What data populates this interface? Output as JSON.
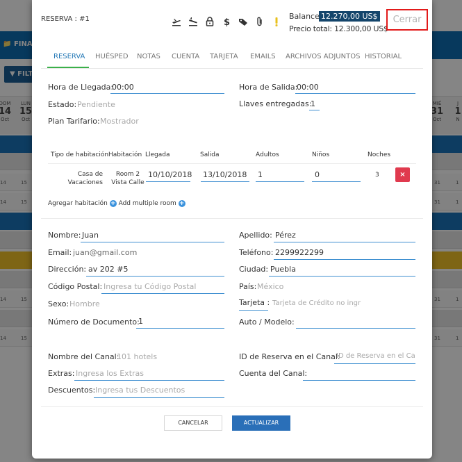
{
  "background": {
    "nav_label": "FINA",
    "filter_label": "FILT",
    "calendar_left": [
      {
        "dow": "DOM",
        "day": "14",
        "month": "Oct"
      },
      {
        "dow": "LUN",
        "day": "15",
        "month": "Oct"
      }
    ],
    "calendar_right": [
      {
        "dow": "MIÉ",
        "day": "31",
        "month": "Oct"
      },
      {
        "dow": "J",
        "day": "1",
        "month": "N"
      }
    ],
    "row_numbers": [
      "14",
      "15",
      "31",
      "1"
    ]
  },
  "modal": {
    "reservation_title": "RESERVA : #1",
    "icons": [
      "plane-departure-icon",
      "plane-arrival-icon",
      "lock-icon",
      "dollar-icon",
      "tags-icon",
      "paperclip-icon",
      "exclamation-icon"
    ],
    "balance_label": "Balance:",
    "balance_value": "12.270,00 US$",
    "total_label": "Precio total: 12.300,00 US$",
    "close_label": "Cerrar",
    "tabs": [
      "RESERVA",
      "HUÉSPED",
      "NOTAS",
      "CUENTA",
      "TARJETA",
      "EMAILS",
      "ARCHIVOS ADJUNTOS",
      "HISTORIAL"
    ],
    "active_tab": "RESERVA",
    "stay": {
      "arrival_label": "Hora de Llegada:",
      "arrival_value": "00:00",
      "departure_label": "Hora de Salida:",
      "departure_value": "00:00",
      "status_label": "Estado:",
      "status_value": "Pendiente",
      "keys_label": "Llaves entregadas:",
      "keys_value": "1",
      "rate_label": "Plan Tarifario:",
      "rate_value": "Mostrador"
    },
    "rooms_table": {
      "headers": [
        "Tipo de habitación",
        "Habitación",
        "Llegada",
        "Salida",
        "Adultos",
        "Niños",
        "Noches"
      ],
      "row": {
        "type_line1": "Casa de",
        "type_line2": "Vacaciones",
        "room_line1": "Room 2",
        "room_line2": "Vista Calle",
        "arrival": "10/10/2018",
        "departure": "13/10/2018",
        "adults": "1",
        "children": "0",
        "nights": "3",
        "delete_symbol": "×"
      },
      "add_room_label": "Agregar habitación",
      "add_multiple_label": "Add multiple room"
    },
    "guest": {
      "name_label": "Nombre:",
      "name_value": "Juan",
      "lastname_label": "Apellido:",
      "lastname_value": "Pérez",
      "email_label": "Email:",
      "email_value": "juan@gmail.com",
      "phone_label": "Teléfono:",
      "phone_value": "2299922299",
      "address_label": "Dirección:",
      "address_value": "av 202 #5",
      "city_label": "Ciudad:",
      "city_value": "Puebla",
      "zip_label": "Código Postal:",
      "zip_placeholder": "Ingresa tu Código Postal",
      "country_label": "País:",
      "country_value": "México",
      "sex_label": "Sexo:",
      "sex_value": "Hombre",
      "card_label": "Tarjeta :",
      "card_placeholder": "Tarjeta de Crédito no ingr",
      "doc_label": "Número de Documento:",
      "doc_value": "1",
      "car_label": "Auto / Modelo:",
      "car_value": ""
    },
    "channel": {
      "channel_name_label": "Nombre del Canal:",
      "channel_name_value": "101 hotels",
      "channel_id_label": "ID de Reserva en el Canal:",
      "channel_id_placeholder": "ID de Reserva en el Ca",
      "extras_label": "Extras:",
      "extras_placeholder": "Ingresa los Extras",
      "account_label": "Cuenta del Canal:",
      "account_value": "",
      "discounts_label": "Descuentos:",
      "discounts_placeholder": "Ingresa tus Descuentos"
    },
    "cancel_label": "CANCELAR",
    "update_label": "ACTUALIZAR"
  }
}
